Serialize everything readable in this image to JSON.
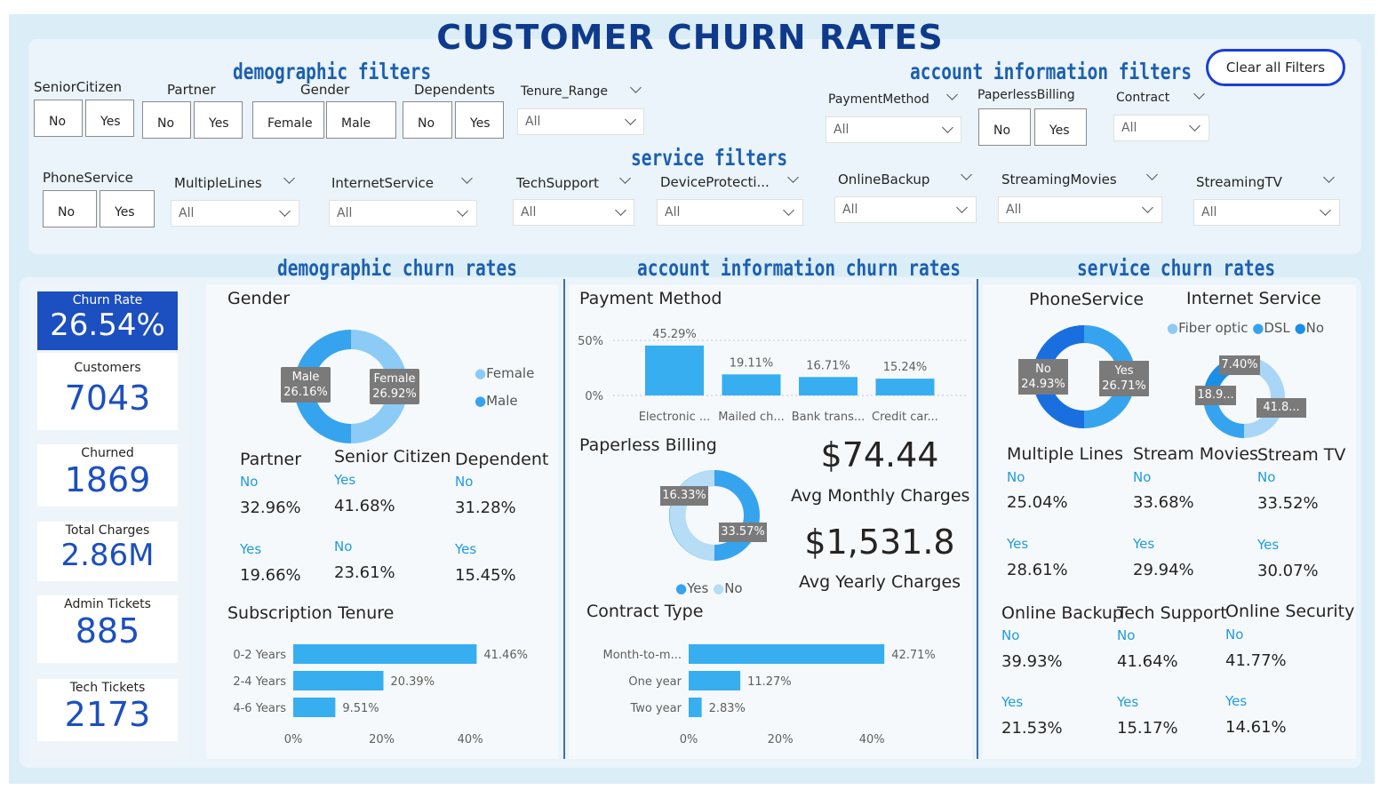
{
  "title": "CUSTOMER CHURN RATES",
  "sections": {
    "demographic_filters": "demographic filters",
    "account_filters": "account information filters",
    "service_filters": "service filters",
    "demographic_rates": "demographic churn rates",
    "account_rates": "account information churn rates",
    "service_rates": "service churn rates"
  },
  "clear_button": "Clear all Filters",
  "filters": {
    "senior": {
      "label": "SeniorCitizen",
      "a": "No",
      "b": "Yes"
    },
    "partner": {
      "label": "Partner",
      "a": "No",
      "b": "Yes"
    },
    "gender": {
      "label": "Gender",
      "a": "Female",
      "b": "Male"
    },
    "dependents": {
      "label": "Dependents",
      "a": "No",
      "b": "Yes"
    },
    "tenure": {
      "label": "Tenure_Range",
      "value": "All"
    },
    "payment": {
      "label": "PaymentMethod",
      "value": "All"
    },
    "paperless": {
      "label": "PaperlessBilling",
      "a": "No",
      "b": "Yes"
    },
    "contract": {
      "label": "Contract",
      "value": "All"
    },
    "phone": {
      "label": "PhoneService",
      "a": "No",
      "b": "Yes"
    },
    "multiple": {
      "label": "MultipleLines",
      "value": "All"
    },
    "internet": {
      "label": "InternetService",
      "value": "All"
    },
    "tech": {
      "label": "TechSupport",
      "value": "All"
    },
    "device": {
      "label": "DeviceProtecti...",
      "value": "All"
    },
    "backup": {
      "label": "OnlineBackup",
      "value": "All"
    },
    "movies": {
      "label": "StreamingMovies",
      "value": "All"
    },
    "tv": {
      "label": "StreamingTV",
      "value": "All"
    }
  },
  "kpis": [
    {
      "label": "Churn Rate",
      "value": "26.54%"
    },
    {
      "label": "Customers",
      "value": "7043"
    },
    {
      "label": "Churned",
      "value": "1869"
    },
    {
      "label": "Total Charges",
      "value": "2.86M"
    },
    {
      "label": "Admin Tickets",
      "value": "885"
    },
    {
      "label": "Tech Tickets",
      "value": "2173"
    }
  ],
  "gender": {
    "title": "Gender",
    "legend": [
      "Female",
      "Male"
    ],
    "male_label": "Male",
    "male_value": "26.16%",
    "female_label": "Female",
    "female_value": "26.92%",
    "colors": {
      "female": "#8ccbf5",
      "male": "#36a3ee"
    }
  },
  "demo_stats": [
    {
      "title": "Partner",
      "l1": "No",
      "v1": "32.96%",
      "l2": "Yes",
      "v2": "19.66%"
    },
    {
      "title": "Senior Citizen",
      "l1": "Yes",
      "v1": "41.68%",
      "l2": "No",
      "v2": "23.61%"
    },
    {
      "title": "Dependent",
      "l1": "No",
      "v1": "31.28%",
      "l2": "Yes",
      "v2": "15.45%"
    }
  ],
  "tenure_title": "Subscription Tenure",
  "payment_title": "Payment Method",
  "paperless": {
    "title": "Paperless Billing",
    "yes_value": "33.57%",
    "no_value": "16.33%",
    "legend_yes": "Yes",
    "legend_no": "No"
  },
  "avg_monthly": {
    "value": "$74.44",
    "label": "Avg Monthly Charges"
  },
  "avg_yearly": {
    "value": "$1,531.8",
    "label": "Avg Yearly Charges"
  },
  "contract_title": "Contract Type",
  "phone": {
    "title": "PhoneService",
    "no_label": "No",
    "no_value": "24.93%",
    "yes_label": "Yes",
    "yes_value": "26.71%"
  },
  "internet": {
    "title": "Internet Service",
    "legend": [
      "Fiber optic",
      "DSL",
      "No"
    ],
    "v_no": "7.40%",
    "v_dsl": "18.9...",
    "v_fiber": "41.8..."
  },
  "service_stats": [
    {
      "title": "Multiple Lines",
      "l1": "No",
      "v1": "25.04%",
      "l2": "Yes",
      "v2": "28.61%"
    },
    {
      "title": "Stream Movies",
      "l1": "No",
      "v1": "33.68%",
      "l2": "Yes",
      "v2": "29.94%"
    },
    {
      "title": "Stream TV",
      "l1": "No",
      "v1": "33.52%",
      "l2": "Yes",
      "v2": "30.07%"
    },
    {
      "title": "Online Backup",
      "l1": "No",
      "v1": "39.93%",
      "l2": "Yes",
      "v2": "21.53%"
    },
    {
      "title": "Tech Support",
      "l1": "No",
      "v1": "41.64%",
      "l2": "Yes",
      "v2": "15.17%"
    },
    {
      "title": "Online Security",
      "l1": "No",
      "v1": "41.77%",
      "l2": "Yes",
      "v2": "14.61%"
    }
  ],
  "chart_data": [
    {
      "type": "bar",
      "title": "Subscription Tenure",
      "categories": [
        "0-2 Years",
        "2-4 Years",
        "4-6 Years"
      ],
      "values": [
        41.46,
        20.39,
        9.51
      ],
      "value_labels": [
        "41.46%",
        "20.39%",
        "9.51%"
      ],
      "xticks": [
        "0%",
        "20%",
        "40%"
      ],
      "xlim": [
        0,
        45
      ],
      "color": "#36aef0"
    },
    {
      "type": "bar",
      "title": "Payment Method",
      "categories": [
        "Electronic ...",
        "Mailed ch...",
        "Bank trans...",
        "Credit car..."
      ],
      "values": [
        45.29,
        19.11,
        16.71,
        15.24
      ],
      "value_labels": [
        "45.29%",
        "19.11%",
        "16.71%",
        "15.24%"
      ],
      "yticks": [
        "50%",
        "0%"
      ],
      "ylim": [
        0,
        50
      ],
      "color": "#36aef0"
    },
    {
      "type": "bar",
      "title": "Contract Type",
      "categories": [
        "Month-to-m...",
        "One year",
        "Two year"
      ],
      "values": [
        42.71,
        11.27,
        2.83
      ],
      "value_labels": [
        "42.71%",
        "11.27%",
        "2.83%"
      ],
      "xticks": [
        "0%",
        "20%",
        "40%"
      ],
      "xlim": [
        0,
        45
      ],
      "color": "#36aef0"
    }
  ]
}
